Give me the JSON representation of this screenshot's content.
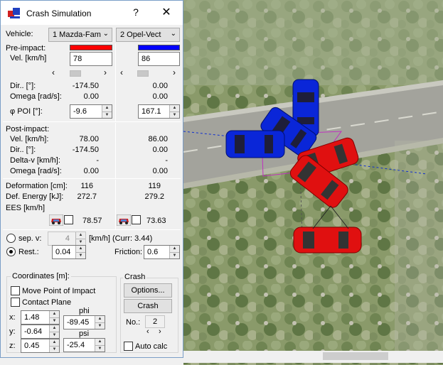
{
  "window": {
    "title": "Crash Simulation",
    "help_glyph": "?",
    "close_glyph": "✕"
  },
  "vehicle": {
    "label": "Vehicle:",
    "v1": {
      "name": "1 Mazda-Fam",
      "color": "#ff0000"
    },
    "v2": {
      "name": "2 Opel-Vect",
      "color": "#0000ff"
    }
  },
  "pre": {
    "title": "Pre-impact:",
    "vel_label": "Vel. [km/h]",
    "v1_vel": "78",
    "v2_vel": "86",
    "dir_label": "Dir.. [°]:",
    "v1_dir": "-174.50",
    "v2_dir": "0.00",
    "omega_label": "Omega [rad/s]:",
    "v1_omega": "0.00",
    "v2_omega": "0.00",
    "phi_label": "φ POI [°]:",
    "v1_phi": "-9.6",
    "v2_phi": "167.1"
  },
  "post": {
    "title": "Post-impact:",
    "vel_label": "Vel. [km/h]:",
    "v1_vel": "78.00",
    "v2_vel": "86.00",
    "dir_label": "Dir.. [°]:",
    "v1_dir": "-174.50",
    "v2_dir": "0.00",
    "dv_label": "Delta-v [km/h]:",
    "v1_dv": "-",
    "v2_dv": "-",
    "omega_label": "Omega [rad/s]:",
    "v1_omega": "0.00",
    "v2_omega": "0.00"
  },
  "energy": {
    "def_label": "Deformation [cm]:",
    "v1_def": "116",
    "v2_def": "119",
    "energy_label": "Def. Energy [kJ]:",
    "v1_energy": "272.7",
    "v2_energy": "279.2",
    "ees_label": "EES [km/h]",
    "v1_ees": "78.57",
    "v2_ees": "73.63"
  },
  "separation": {
    "sepv_label": "sep. v:",
    "sepv_value": "4",
    "unit_curr": "[km/h] (Curr: 3.44)",
    "rest_label": "Rest.:",
    "rest_value": "0.04",
    "friction_label": "Friction:",
    "friction_value": "0.6"
  },
  "coordinates": {
    "title": "Coordinates [m]:",
    "move_poi": "Move Point of Impact",
    "contact_plane": "Contact Plane",
    "x_label": "x:",
    "x_value": "1.48",
    "y_label": "y:",
    "y_value": "-0.64",
    "z_label": "z:",
    "z_value": "0.45",
    "phi_label": "phi",
    "phi_value": "-89.45",
    "psi_label": "psi",
    "psi_value": "-25.4"
  },
  "crash": {
    "title": "Crash",
    "options_button": "Options...",
    "crash_button": "Crash",
    "no_label": "No.:",
    "no_value": "2",
    "autocalc": "Auto calc"
  },
  "icons": [
    "app-logo-icon",
    "help-icon",
    "close-icon",
    "car-icon",
    "chevron-left-icon",
    "chevron-right-icon"
  ]
}
